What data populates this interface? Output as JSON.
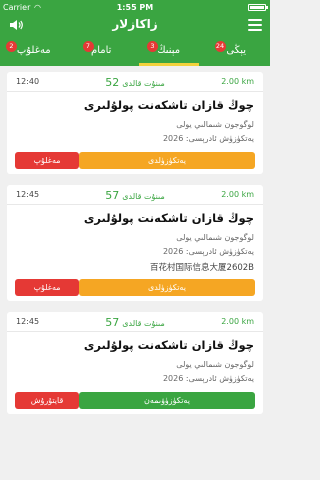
{
  "status": {
    "carrier": "Carrier",
    "time": "1:55 PM"
  },
  "header": {
    "title": "زاكازلار"
  },
  "tabs": [
    {
      "label": "مەغلۇپ",
      "badge": "2"
    },
    {
      "label": "تامام",
      "badge": "7"
    },
    {
      "label": "مېنىڭ",
      "badge": "3"
    },
    {
      "label": "يېڭى",
      "badge": "24"
    }
  ],
  "orders": [
    {
      "time": "12:40",
      "minutes": "52",
      "minutes_suffix": "مىنۇت قالدى",
      "distance": "2.00 km",
      "title": "چوڭ قازان تاشكەنت پولۇلىرى",
      "line1": "لوگوجون شىمالىي يولى",
      "line2": "يەتكۈزۈش ئادرېسى: 2026",
      "primary_button": "يەتكۈزۈلدى",
      "secondary_button": "مەغلۇپ"
    },
    {
      "time": "12:45",
      "minutes": "57",
      "minutes_suffix": "مىنۇت قالدى",
      "distance": "2.00 km",
      "title": "چوڭ قازان تاشكەنت پولۇلىرى",
      "line1": "لوگوجون شىمالىي يولى",
      "line2": "يەتكۈزۈش ئادرېسى: 2026",
      "line3": "百花村国际信息大厦2602B",
      "primary_button": "يەتكۈزۈلدى",
      "secondary_button": "مەغلۇپ"
    },
    {
      "time": "12:45",
      "minutes": "57",
      "minutes_suffix": "مىنۇت قالدى",
      "distance": "2.00 km",
      "title": "چوڭ قازان تاشكەنت پولۇلىرى",
      "line1": "لوگوجون شىمالىي يولى",
      "line2": "يەتكۈزۈش ئادرېسى: 2026",
      "primary_button": "يەتكۈزۈۋىمەن",
      "secondary_button": "قايتۇرۇش"
    }
  ]
}
